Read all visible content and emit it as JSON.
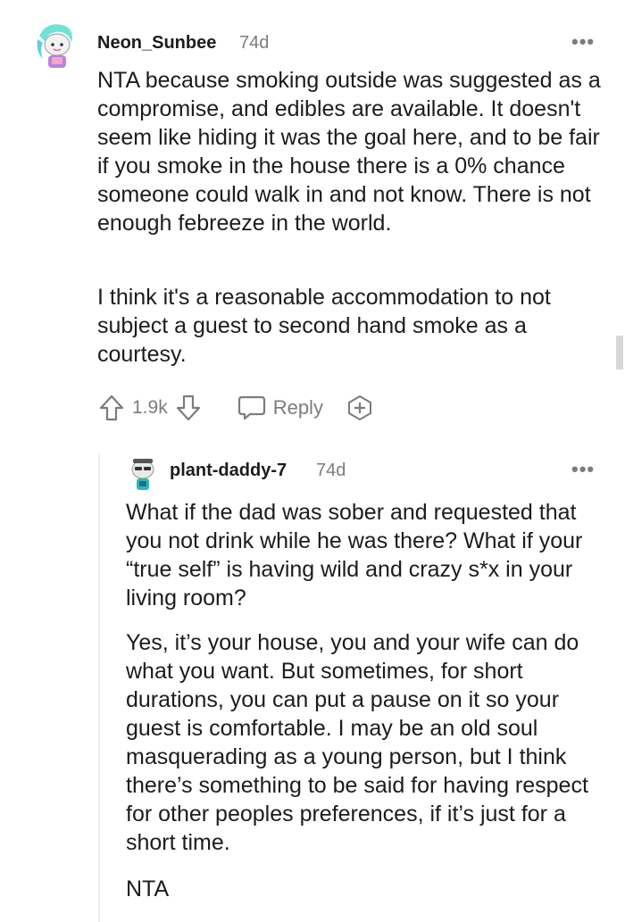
{
  "comment1": {
    "username": "Neon_Sunbee",
    "age": "74d",
    "more_label": "•••",
    "paragraphs": [
      "NTA because smoking outside was suggested as a compromise, and edibles are available. It doesn't seem like hiding it was the goal here, and to be fair if you smoke in the house there is a 0% chance someone could walk in and not know. There is not enough febreeze in the world.",
      "I think it's a reasonable accommodation to not subject a guest to second hand smoke as a courtesy."
    ],
    "vote_count": "1.9k",
    "reply_label": "Reply",
    "avatar_icon": "snoo-avatar-icon"
  },
  "comment2": {
    "username": "plant-daddy-7",
    "age": "74d",
    "more_label": "•••",
    "paragraphs": [
      "What if the dad was sober and requested that you not drink while he was there? What if your “true self” is having wild and crazy s*x in your living room?",
      "Yes, it’s your house, you and your wife can do what you want. But sometimes, for short durations, you can put a pause on it so your guest is comfortable. I may be an old soul masquerading as a young person, but I think there’s something to be said for having respect for other peoples preferences, if it’s just for a short time.",
      "NTA"
    ],
    "avatar_icon": "snoo-avatar-icon"
  },
  "colors": {
    "text": "#1c1c1c",
    "meta": "#7c7c7c",
    "thread_line": "#edeff1"
  }
}
